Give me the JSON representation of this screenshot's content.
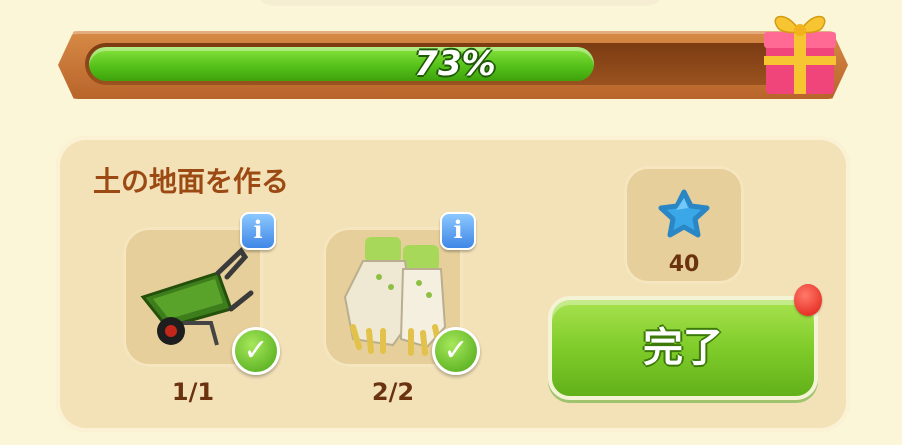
{
  "progress": {
    "fraction": 0.73,
    "label": "73%"
  },
  "task": {
    "title": "土の地面を作る",
    "items": [
      {
        "icon": "wheelbarrow-icon",
        "count": "1/1",
        "complete": true
      },
      {
        "icon": "gardening-gloves-icon",
        "count": "2/2",
        "complete": true
      }
    ],
    "reward": {
      "icon": "blue-star-icon",
      "amount": "40"
    },
    "complete_button_label": "完了"
  },
  "colors": {
    "progress_fill": "#56c21a",
    "frame": "#b8642a",
    "panel": "#f3e2b8",
    "title_text": "#9c4a14",
    "button": "#7fcc2a"
  }
}
